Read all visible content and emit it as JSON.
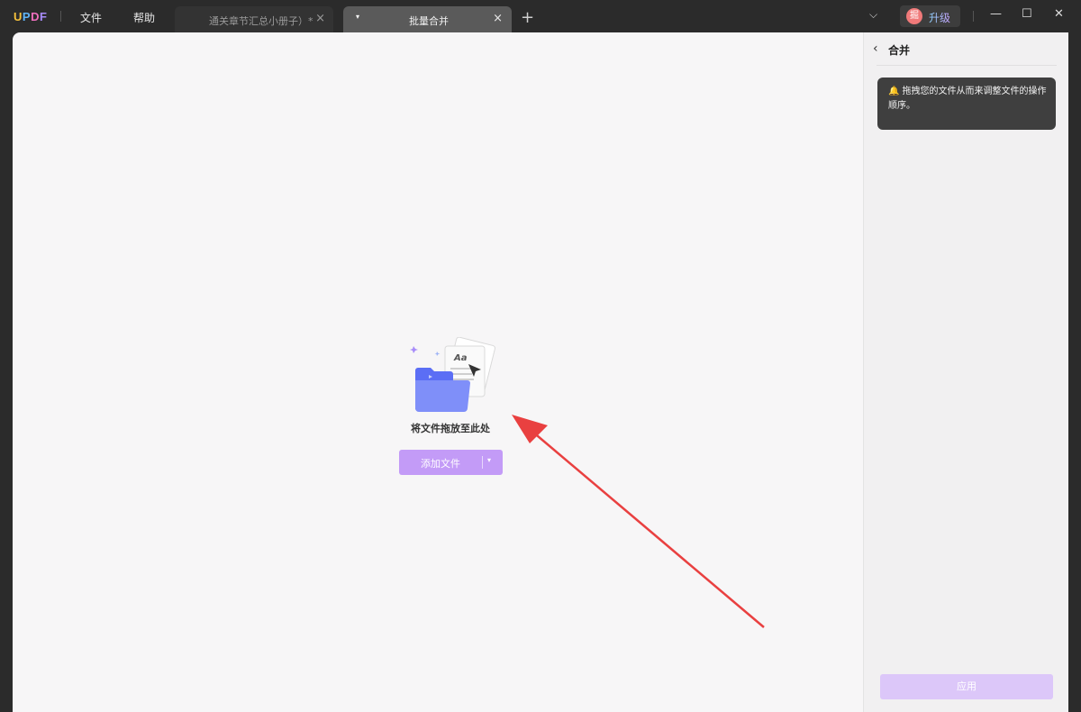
{
  "app": {
    "logo": {
      "u": "U",
      "p": "P",
      "d": "D",
      "f": "F"
    },
    "menu": {
      "file": "文件",
      "help": "帮助"
    }
  },
  "tabs": [
    {
      "label": "通关章节汇总小册子）*",
      "close": "×"
    },
    {
      "label": "批量合并",
      "close": "×",
      "dropdown": "▾"
    }
  ],
  "tab_add": "+",
  "titlebar_right": {
    "dropdown": "⌵",
    "upgrade_avatar": "掘",
    "upgrade_label": "升级",
    "minimize": "—",
    "maximize": "☐",
    "close": "✕"
  },
  "main": {
    "drop_text": "将文件拖放至此处",
    "illustration_text": "Aa",
    "add_button": {
      "label": "添加文件",
      "caret": "▾"
    }
  },
  "panel": {
    "back": "‹",
    "title": "合并",
    "tip": "拖拽您的文件从而来调整文件的操作顺序。",
    "tip_icon": "🔔",
    "apply": "应用"
  },
  "colors": {
    "accent": "#c39bf7",
    "accent_disabled": "#dcc7f9",
    "annotation_arrow": "#e94040",
    "titlebar": "#2b2b2b",
    "canvas": "#f7f6f7"
  }
}
